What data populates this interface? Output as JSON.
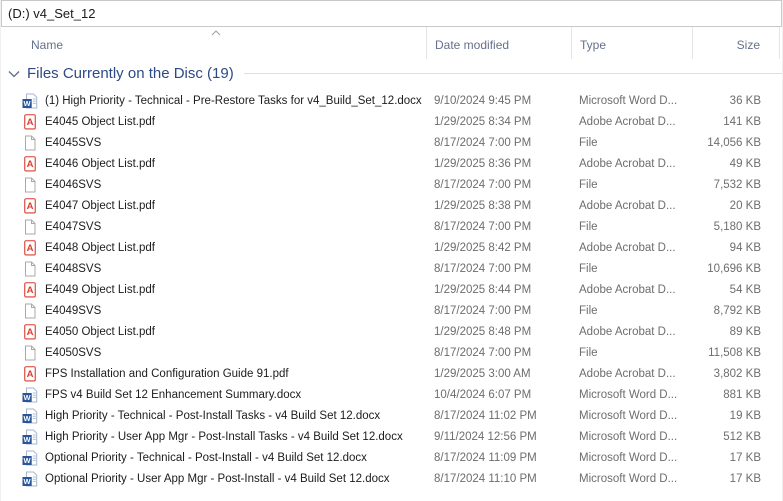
{
  "window": {
    "title": "(D:) v4_Set_12"
  },
  "columns": {
    "name": "Name",
    "date_modified": "Date modified",
    "type": "Type",
    "size": "Size",
    "sort_column": "Name",
    "sort_direction": "ascending"
  },
  "group": {
    "label": "Files Currently on the Disc (19)",
    "expanded": true
  },
  "icons": {
    "word": "word-document-icon",
    "pdf": "adobe-acrobat-icon",
    "file": "generic-file-icon",
    "sort": "sort-ascending-chevron-icon",
    "group": "chevron-down-icon",
    "word_letter": "W",
    "pdf_letter": "A"
  },
  "colors": {
    "group_header_text": "#2c4a86",
    "column_header_text": "#66708c",
    "file_name_text": "#1c1c1c",
    "meta_text": "#6d6d6d",
    "word_blue": "#2a5699",
    "acrobat_red": "#dc3c2f",
    "divider": "#e5e5e5"
  },
  "files": [
    {
      "icon": "word",
      "name": "(1) High Priority - Technical - Pre-Restore Tasks for v4_Build_Set_12.docx",
      "date_modified": "9/10/2024 9:45 PM",
      "type": "Microsoft Word D...",
      "size": "36 KB"
    },
    {
      "icon": "pdf",
      "name": "E4045 Object List.pdf",
      "date_modified": "1/29/2025 8:34 PM",
      "type": "Adobe Acrobat D...",
      "size": "141 KB"
    },
    {
      "icon": "file",
      "name": "E4045SVS",
      "date_modified": "8/17/2024 7:00 PM",
      "type": "File",
      "size": "14,056 KB"
    },
    {
      "icon": "pdf",
      "name": "E4046 Object List.pdf",
      "date_modified": "1/29/2025 8:36 PM",
      "type": "Adobe Acrobat D...",
      "size": "49 KB"
    },
    {
      "icon": "file",
      "name": "E4046SVS",
      "date_modified": "8/17/2024 7:00 PM",
      "type": "File",
      "size": "7,532 KB"
    },
    {
      "icon": "pdf",
      "name": "E4047 Object List.pdf",
      "date_modified": "1/29/2025 8:38 PM",
      "type": "Adobe Acrobat D...",
      "size": "20 KB"
    },
    {
      "icon": "file",
      "name": "E4047SVS",
      "date_modified": "8/17/2024 7:00 PM",
      "type": "File",
      "size": "5,180 KB"
    },
    {
      "icon": "pdf",
      "name": "E4048 Object List.pdf",
      "date_modified": "1/29/2025 8:42 PM",
      "type": "Adobe Acrobat D...",
      "size": "94 KB"
    },
    {
      "icon": "file",
      "name": "E4048SVS",
      "date_modified": "8/17/2024 7:00 PM",
      "type": "File",
      "size": "10,696 KB"
    },
    {
      "icon": "pdf",
      "name": "E4049 Object List.pdf",
      "date_modified": "1/29/2025 8:44 PM",
      "type": "Adobe Acrobat D...",
      "size": "54 KB"
    },
    {
      "icon": "file",
      "name": "E4049SVS",
      "date_modified": "8/17/2024 7:00 PM",
      "type": "File",
      "size": "8,792 KB"
    },
    {
      "icon": "pdf",
      "name": "E4050 Object List.pdf",
      "date_modified": "1/29/2025 8:48 PM",
      "type": "Adobe Acrobat D...",
      "size": "89 KB"
    },
    {
      "icon": "file",
      "name": "E4050SVS",
      "date_modified": "8/17/2024 7:00 PM",
      "type": "File",
      "size": "11,508 KB"
    },
    {
      "icon": "pdf",
      "name": "FPS Installation and Configuration Guide 91.pdf",
      "date_modified": "1/29/2025 3:00 AM",
      "type": "Adobe Acrobat D...",
      "size": "3,802 KB"
    },
    {
      "icon": "word",
      "name": "FPS v4 Build Set 12 Enhancement Summary.docx",
      "date_modified": "10/4/2024 6:07 PM",
      "type": "Microsoft Word D...",
      "size": "881 KB"
    },
    {
      "icon": "word",
      "name": "High Priority - Technical - Post-Install Tasks - v4 Build Set 12.docx",
      "date_modified": "8/17/2024 11:02 PM",
      "type": "Microsoft Word D...",
      "size": "19 KB"
    },
    {
      "icon": "word",
      "name": "High Priority - User App Mgr - Post-Install Tasks - v4 Build Set 12.docx",
      "date_modified": "9/11/2024 12:56 PM",
      "type": "Microsoft Word D...",
      "size": "512 KB"
    },
    {
      "icon": "word",
      "name": "Optional Priority - Technical - Post-Install - v4 Build Set 12.docx",
      "date_modified": "8/17/2024 11:09 PM",
      "type": "Microsoft Word D...",
      "size": "17 KB"
    },
    {
      "icon": "word",
      "name": "Optional Priority - User App Mgr - Post-Install - v4 Build Set 12.docx",
      "date_modified": "8/17/2024 11:10 PM",
      "type": "Microsoft Word D...",
      "size": "17 KB"
    }
  ]
}
